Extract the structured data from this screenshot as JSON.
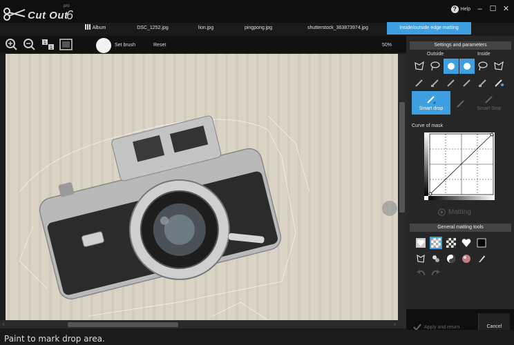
{
  "app": {
    "name": "Cut Out",
    "edition": "pro",
    "version": "6"
  },
  "window": {
    "help_label": "Help"
  },
  "tabs": [
    {
      "label": "Album",
      "active": false
    },
    {
      "label": "DSC_1252.jpg",
      "active": false
    },
    {
      "label": "lion.jpg",
      "active": false
    },
    {
      "label": "pingpong.jpg",
      "active": false
    },
    {
      "label": "shutterstock_363873974.jpg",
      "active": false
    },
    {
      "label": "Inside/outside edge matting",
      "active": true
    }
  ],
  "toolbar": {
    "set_brush_label": "Set brush",
    "reset_label": "Reset",
    "zoom_level": "50%"
  },
  "panel": {
    "settings_header": "Settings and parameters",
    "outside_label": "Outside",
    "inside_label": "Inside",
    "smart_drop_label": "Smart drop",
    "smart_stop_label": "Smart Stop",
    "curve_label": "Curve of mask",
    "matting_label": "Matting",
    "general_header": "General matting tools"
  },
  "footer": {
    "apply_label": "Apply and return",
    "cancel_label": "Cancel"
  },
  "status": {
    "text": "Paint to mark drop area."
  },
  "colors": {
    "accent": "#3ea0e0",
    "background": "#1a1a1a",
    "panel": "#262626"
  }
}
